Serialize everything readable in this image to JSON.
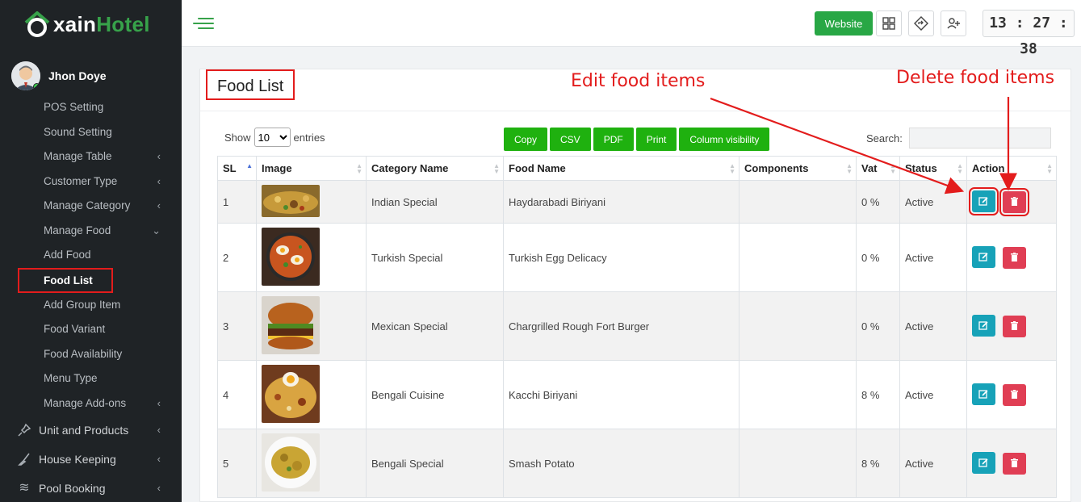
{
  "brand": {
    "name_prefix": "xain",
    "name_suffix": "Hotel",
    "colors": {
      "accent": "#37a24a",
      "sidebar_bg": "#1f2326"
    }
  },
  "user": {
    "name": "Jhon Doye",
    "icon": "user-avatar"
  },
  "sidebar": {
    "items": [
      {
        "label": "POS Setting",
        "chev": ""
      },
      {
        "label": "Sound Setting",
        "chev": ""
      },
      {
        "label": "Manage Table",
        "chev": "‹"
      },
      {
        "label": "Customer Type",
        "chev": "‹"
      },
      {
        "label": "Manage Category",
        "chev": "‹"
      },
      {
        "label": "Manage Food",
        "chev": "⌄"
      },
      {
        "label": "Add Food",
        "chev": ""
      },
      {
        "label": "Food List",
        "chev": ""
      },
      {
        "label": "Add Group Item",
        "chev": ""
      },
      {
        "label": "Food Variant",
        "chev": ""
      },
      {
        "label": "Food Availability",
        "chev": ""
      },
      {
        "label": "Menu Type",
        "chev": ""
      },
      {
        "label": "Manage Add-ons",
        "chev": "‹"
      }
    ],
    "sections": [
      {
        "label": "Unit and Products",
        "icon": "pin-icon",
        "chev": "‹"
      },
      {
        "label": "House Keeping",
        "icon": "broom-icon",
        "chev": "‹"
      },
      {
        "label": "Pool Booking",
        "icon": "wave-icon",
        "chev": "‹"
      }
    ]
  },
  "topbar": {
    "website_label": "Website",
    "clock": "13 : 27 : 38"
  },
  "page": {
    "title": "Food List",
    "annotations": {
      "edit": "Edit food items",
      "delete": "Delete food items"
    }
  },
  "controls": {
    "show_label": "Show",
    "entries_label": "entries",
    "page_size": "10",
    "export_buttons": [
      "Copy",
      "CSV",
      "PDF",
      "Print",
      "Column visibility"
    ],
    "search_label": "Search:"
  },
  "table": {
    "columns": [
      "SL",
      "Image",
      "Category Name",
      "Food Name",
      "Components",
      "Vat",
      "Status",
      "Action"
    ],
    "rows": [
      {
        "sl": "1",
        "category": "Indian Special",
        "food": "Haydarabadi Biriyani",
        "components": "",
        "vat": "0 %",
        "status": "Active",
        "image": "biriyani-image"
      },
      {
        "sl": "2",
        "category": "Turkish Special",
        "food": "Turkish Egg Delicacy",
        "components": "",
        "vat": "0 %",
        "status": "Active",
        "image": "egg-dish-image"
      },
      {
        "sl": "3",
        "category": "Mexican Special",
        "food": "Chargrilled Rough Fort Burger",
        "components": "",
        "vat": "0 %",
        "status": "Active",
        "image": "burger-image"
      },
      {
        "sl": "4",
        "category": "Bengali Cuisine",
        "food": "Kacchi Biriyani",
        "components": "",
        "vat": "8 %",
        "status": "Active",
        "image": "kacchi-image"
      },
      {
        "sl": "5",
        "category": "Bengali Special",
        "food": "Smash Potato",
        "components": "",
        "vat": "8 %",
        "status": "Active",
        "image": "potato-image"
      }
    ]
  }
}
